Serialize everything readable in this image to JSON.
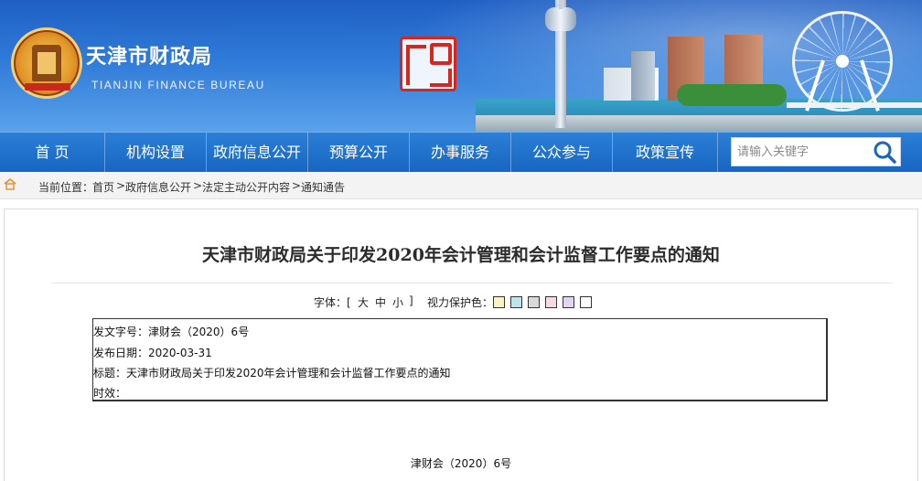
{
  "header": {
    "site_title": "天津市财政局",
    "site_subtitle": "TIANJIN FINANCE BUREAU"
  },
  "nav": {
    "items": [
      {
        "label": "首 页"
      },
      {
        "label": "机构设置"
      },
      {
        "label": "政府信息公开"
      },
      {
        "label": "预算公开"
      },
      {
        "label": "办事服务"
      },
      {
        "label": "公众参与"
      },
      {
        "label": "政策宣传"
      }
    ],
    "search_placeholder": "请输入关键字",
    "active_color": "#1766c1"
  },
  "breadcrumb": {
    "label": "当前位置：",
    "items": [
      "首页",
      "政府信息公开",
      "法定主动公开内容",
      "通知通告"
    ],
    "separator": ">"
  },
  "article": {
    "title": "天津市财政局关于印发2020年会计管理和会计监督工作要点的通知",
    "font_size_label": "字体：[",
    "font_sizes": [
      "大",
      "中",
      "小"
    ],
    "font_size_close": "]",
    "eye_care_label": "视力保护色：",
    "eye_care_colors": [
      "#f9f2c4",
      "#b9e6ec",
      "#d9d9d9",
      "#f6d9e4",
      "#e4d4f3",
      "#ffffff"
    ],
    "meta": {
      "doc_no_label": "发文字号：",
      "doc_no": "津财会（2020）6号",
      "date_label": "发布日期：",
      "date": "2020-03-31",
      "subject_label": "标题：",
      "subject": "天津市财政局关于印发2020年会计管理和会计监督工作要点的通知",
      "validity_label": "时效：",
      "validity": ""
    },
    "body_doc_no": "津财会（2020）6号"
  }
}
